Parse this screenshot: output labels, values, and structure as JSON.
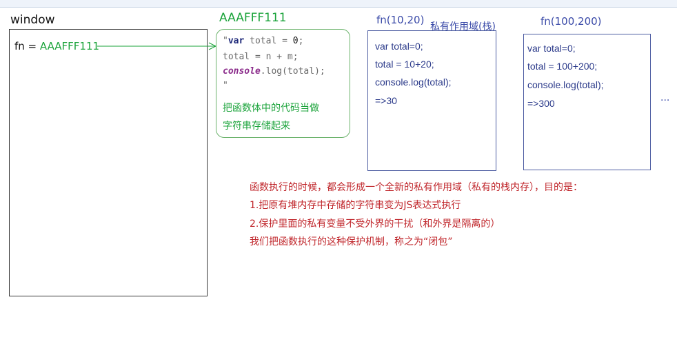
{
  "window_section": {
    "label": "window",
    "fn_name": "fn = ",
    "fn_value": "AAAFFF111"
  },
  "heap": {
    "address": "AAAFFF111",
    "code": {
      "line1_quote": "\"",
      "line1_kw": "var",
      "line1_rest": " total = ",
      "line1_num": "0",
      "line1_end": ";",
      "line2": "total = n + m;",
      "line3_obj": "console",
      "line3_rest": ".log(total);",
      "line4": "\""
    },
    "note_line1": "把函数体中的代码当做",
    "note_line2": "字符串存储起来"
  },
  "call1": {
    "title": "fn(10,20)",
    "scope_label": "私有作用域(栈)",
    "lines": [
      "var total=0;",
      "total = 10+20;",
      "console.log(total);",
      "=>30"
    ]
  },
  "call2": {
    "title": "fn(100,200)",
    "lines": [
      "var total=0;",
      "total = 100+200;",
      "console.log(total);",
      "=>300"
    ]
  },
  "ellipsis": "...",
  "explanation": {
    "lines": [
      "函数执行的时候，都会形成一个全新的私有作用域（私有的栈内存），目的是：",
      "1.把原有堆内存中存储的字符串变为JS表达式执行",
      "2.保护里面的私有变量不受外界的干扰（和外界是隔离的）",
      "我们把函数执行的这种保护机制，称之为“闭包”"
    ]
  },
  "colors": {
    "green": "#1aa33a",
    "blue": "#3a4aa8",
    "red": "#c0262b"
  }
}
